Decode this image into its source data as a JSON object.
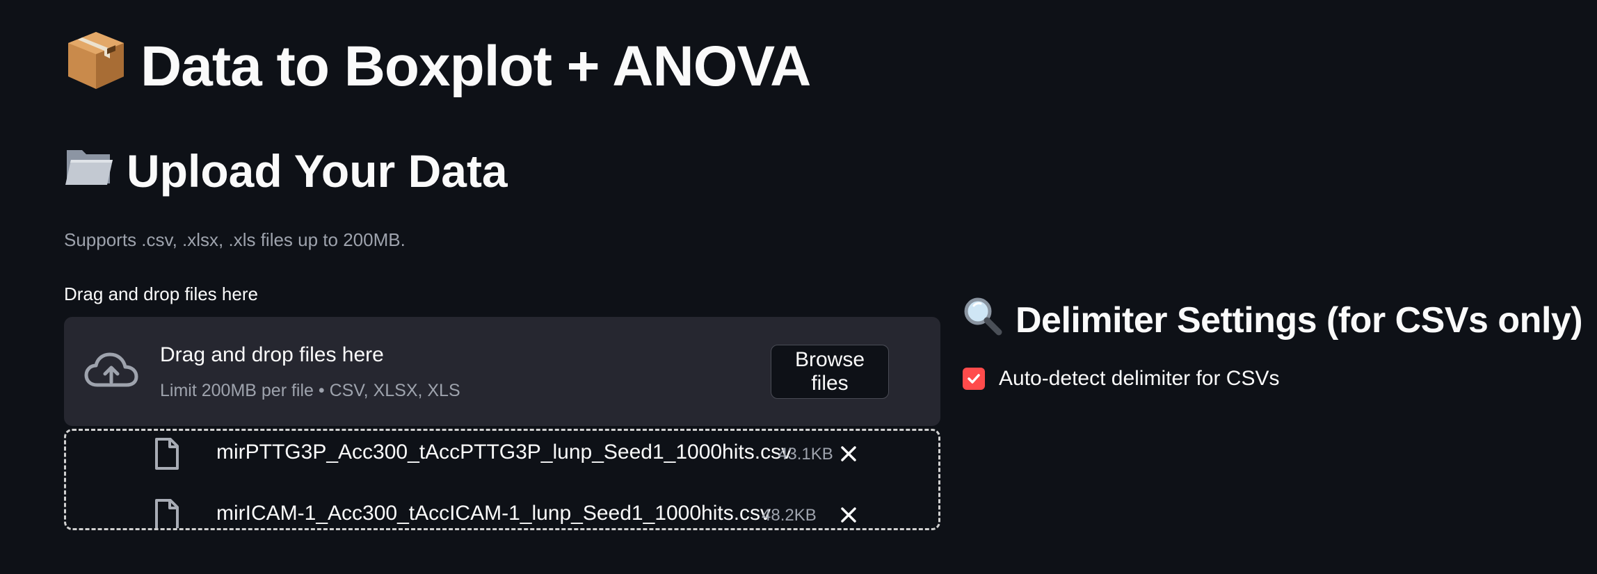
{
  "header": {
    "title_icon": "package-icon",
    "title": "Data to Boxplot + ANOVA"
  },
  "upload": {
    "heading_icon": "folder-icon",
    "heading": "Upload Your Data",
    "caption": "Supports .csv, .xlsx, .xls files up to 200MB.",
    "label": "Drag and drop files here",
    "dropzone": {
      "icon": "cloud-upload-icon",
      "main_text": "Drag and drop files here",
      "sub_text": "Limit 200MB per file • CSV, XLSX, XLS",
      "browse_label": "Browse files"
    },
    "files": [
      {
        "name": "mirPTTG3P_Acc300_tAccPTTG3P_lunp_Seed1_1000hits.csv",
        "size": "43.1KB"
      },
      {
        "name": "mirICAM-1_Acc300_tAccICAM-1_lunp_Seed1_1000hits.csv",
        "size": "48.2KB"
      }
    ]
  },
  "delimiter": {
    "heading_icon": "magnifier-icon",
    "heading": "Delimiter Settings (for CSVs only)",
    "auto_detect_label": "Auto-detect delimiter for CSVs",
    "auto_detect_checked": true
  },
  "colors": {
    "background": "#0e1117",
    "surface": "#262730",
    "accent": "#ff4b4b",
    "muted_text": "#9ea3ad"
  }
}
